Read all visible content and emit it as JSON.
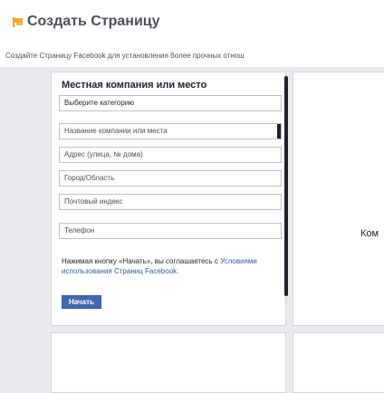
{
  "header": {
    "title": "Создать Страницу",
    "subtitle": "Создайте Страницу Facebook для установления более прочных отнош",
    "icon": "create-page-flag-icon",
    "icon_color": "#f5a623"
  },
  "card": {
    "title": "Местная компания или место",
    "category_select": "Выберите категорию",
    "fields": {
      "business_name": "Название компании или места",
      "address": "Адрес (улица, № дома)",
      "city": "Город/Область",
      "zip": "Почтовый индекс",
      "phone": "Телефон"
    },
    "terms": {
      "text": "Нажимая кнопку «Начать», вы соглашаетесь с",
      "link": "Условиями использования Страниц Facebook."
    },
    "start_button": "Начать"
  },
  "right_card": {
    "label": "Ком"
  },
  "colors": {
    "background": "#e9ebee",
    "button": "#4267b2",
    "link": "#365899"
  }
}
